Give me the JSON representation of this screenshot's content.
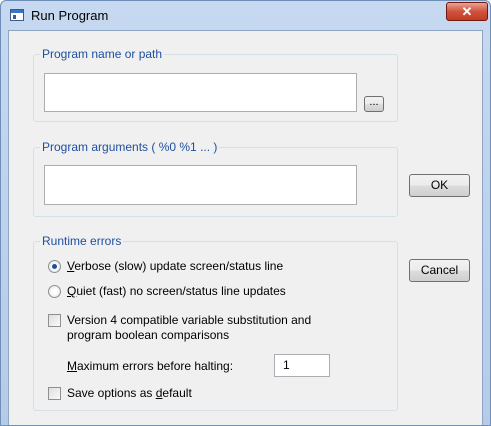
{
  "window": {
    "title": "Run Program",
    "close_glyph": "✕",
    "icon": "program-window-icon"
  },
  "program_name": {
    "legend": "Program name or path",
    "value": "",
    "browse_label": "..."
  },
  "program_args": {
    "legend": "Program arguments ( %0  %1 ... )",
    "value": ""
  },
  "runtime_errors": {
    "legend": "Runtime errors",
    "verbose_key": "V",
    "verbose_rest": "erbose (slow) update screen/status line",
    "verbose_selected": true,
    "quiet_key": "Q",
    "quiet_rest": "uiet (fast) no screen/status line updates",
    "quiet_selected": false,
    "v4_line1": "Version 4 compatible variable substitution and",
    "v4_line2": "program boolean comparisons",
    "v4_checked": false,
    "max_errors_key": "M",
    "max_errors_rest": "aximum errors before halting:",
    "max_errors_value": "1"
  },
  "save_default": {
    "label_pre": "Save options as ",
    "label_key": "d",
    "label_post": "efault",
    "checked": false
  },
  "buttons": {
    "ok": "OK",
    "cancel": "Cancel"
  },
  "colors": {
    "legend_text": "#1e4fa2",
    "title_bar": "#c6d9f1",
    "close_button": "#c43a22"
  }
}
